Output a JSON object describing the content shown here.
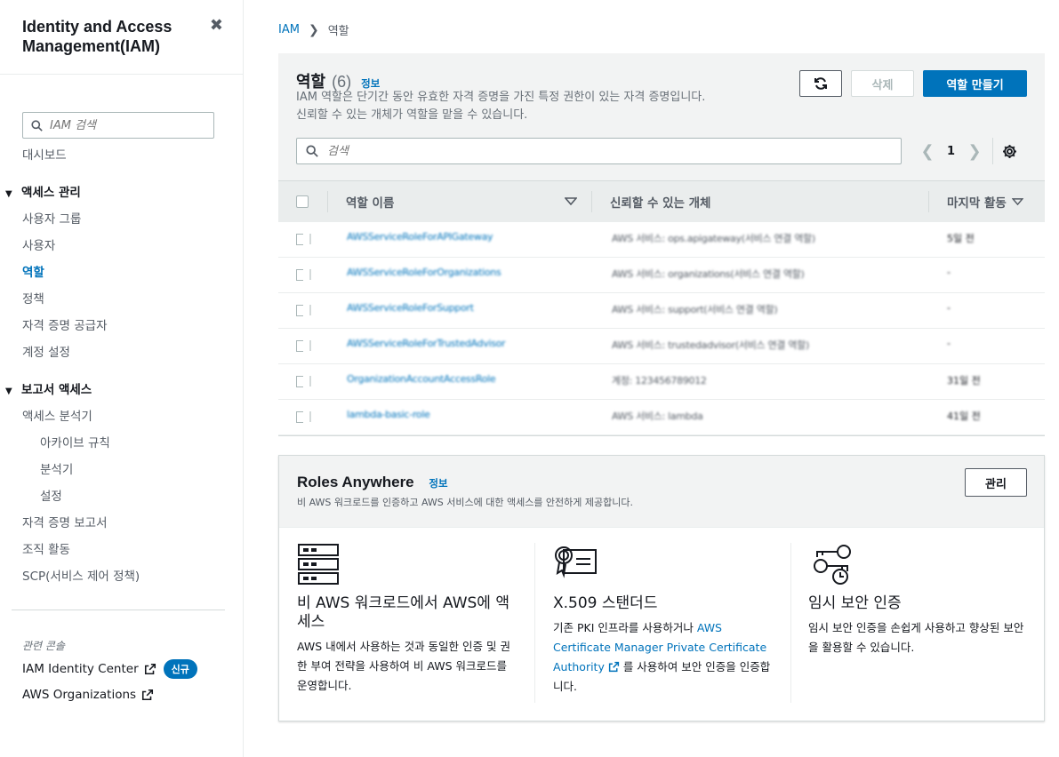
{
  "sidebar": {
    "title": "Identity and Access Management(IAM)",
    "close_glyph": "✖",
    "search_placeholder": "IAM 검색",
    "dashboard": "대시보드",
    "access_mgmt": {
      "label": "액세스 관리",
      "items": [
        "사용자 그룹",
        "사용자",
        "역할",
        "정책",
        "자격 증명 공급자",
        "계정 설정"
      ]
    },
    "report_access": {
      "label": "보고서 액세스",
      "analyzer": "액세스 분석기",
      "analyzer_sub": [
        "아카이브 규칙",
        "분석기",
        "설정"
      ],
      "items": [
        "자격 증명 보고서",
        "조직 활동",
        "SCP(서비스 제어 정책)"
      ]
    },
    "related_title": "관련 콘솔",
    "identity_center": "IAM Identity Center",
    "new_badge": "신규",
    "organizations": "AWS Organizations"
  },
  "breadcrumb": {
    "root": "IAM",
    "current": "역할"
  },
  "roles": {
    "title": "역할",
    "count": "(6)",
    "info": "정보",
    "desc_line1": "IAM 역할은 단기간 동안 유효한 자격 증명을 가진 특정 권한이 있는 자격 증명입니다.",
    "desc_line2": "신뢰할 수 있는 개체가 역할을 맡을 수 있습니다.",
    "delete_label": "삭제",
    "create_label": "역할 만들기",
    "search_placeholder": "검색",
    "page": "1",
    "columns": {
      "name": "역할 이름",
      "trusted": "신뢰할 수 있는 개체",
      "last": "마지막 활동"
    },
    "rows": [
      {
        "name": "AWSServiceRoleForAPIGateway",
        "trusted": "AWS 서비스: ops.apigateway(서비스 연결 역할)",
        "last": "5일 전"
      },
      {
        "name": "AWSServiceRoleForOrganizations",
        "trusted": "AWS 서비스: organizations(서비스 연결 역할)",
        "last": "-"
      },
      {
        "name": "AWSServiceRoleForSupport",
        "trusted": "AWS 서비스: support(서비스 연결 역할)",
        "last": "-"
      },
      {
        "name": "AWSServiceRoleForTrustedAdvisor",
        "trusted": "AWS 서비스: trustedadvisor(서비스 연결 역할)",
        "last": "-"
      },
      {
        "name": "OrganizationAccountAccessRole",
        "trusted": "계정: 123456789012",
        "last": "31일 전"
      },
      {
        "name": "lambda-basic-role",
        "trusted": "AWS 서비스: lambda",
        "last": "41일 전"
      }
    ]
  },
  "roles_anywhere": {
    "title": "Roles Anywhere",
    "info": "정보",
    "desc": "비 AWS 워크로드를 인증하고 AWS 서비스에 대한 액세스를 안전하게 제공합니다.",
    "manage_label": "관리",
    "col1": {
      "icon": "server-stack-icon",
      "heading": "비 AWS 워크로드에서 AWS에 액세스",
      "text": "AWS 내에서 사용하는 것과 동일한 인증 및 권한 부여 전략을 사용하여 비 AWS 워크로드를 운영합니다."
    },
    "col2": {
      "icon": "certificate-icon",
      "heading": "X.509 스탠더드",
      "text_before": "기존 PKI 인프라를 사용하거나 ",
      "link": "AWS Certificate Manager Private Certificate Authority",
      "text_after": " 를 사용하여 보안 인증을 인증합니다."
    },
    "col3": {
      "icon": "keys-clock-icon",
      "heading": "임시 보안 인증",
      "text": "임시 보안 인증을 손쉽게 사용하고 향상된 보안을 활용할 수 있습니다."
    }
  },
  "colors": {
    "accent": "#0073bb",
    "header_bg": "#f2f3f3",
    "text": "#16191f"
  }
}
